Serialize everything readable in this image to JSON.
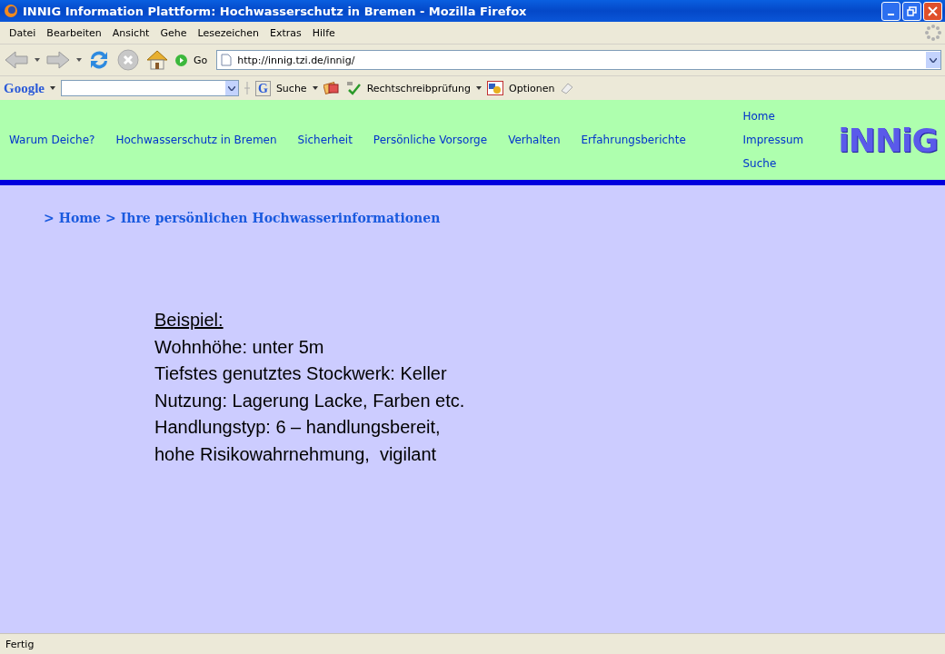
{
  "window": {
    "title": "INNIG Information Plattform: Hochwasserschutz in Bremen - Mozilla Firefox"
  },
  "menu_bar": {
    "items": [
      "Datei",
      "Bearbeiten",
      "Ansicht",
      "Gehe",
      "Lesezeichen",
      "Extras",
      "Hilfe"
    ]
  },
  "navigation_toolbar": {
    "go_label": "Go",
    "address": "http://innig.tzi.de/innig/"
  },
  "google_toolbar": {
    "logo": "Google",
    "search_glyph": "G",
    "search_label": "Suche",
    "spellcheck_label": "Rechtschreibprüfung",
    "options_label": "Optionen"
  },
  "site_header": {
    "nav": [
      "Warum Deiche?",
      "Hochwasserschutz in Bremen",
      "Sicherheit",
      "Persönliche Vorsorge",
      "Verhalten",
      "Erfahrungsberichte"
    ],
    "side_links": [
      "Home",
      "Impressum",
      "Suche"
    ],
    "logo": "iNNiG"
  },
  "breadcrumb": {
    "prefix": ">",
    "link": "Home",
    "separator": ">",
    "current": "Ihre persönlichen Hochwasserinformationen"
  },
  "example": {
    "heading": "Beispiel:",
    "lines": [
      "Wohnhöhe: unter 5m",
      "Tiefstes genutztes Stockwerk: Keller",
      "Nutzung: Lagerung Lacke, Farben etc.",
      "Handlungstyp: 6 – handlungsbereit,",
      "hohe Risikowahrnehmung,  vigilant"
    ]
  },
  "status_bar": {
    "text": "Fertig"
  }
}
